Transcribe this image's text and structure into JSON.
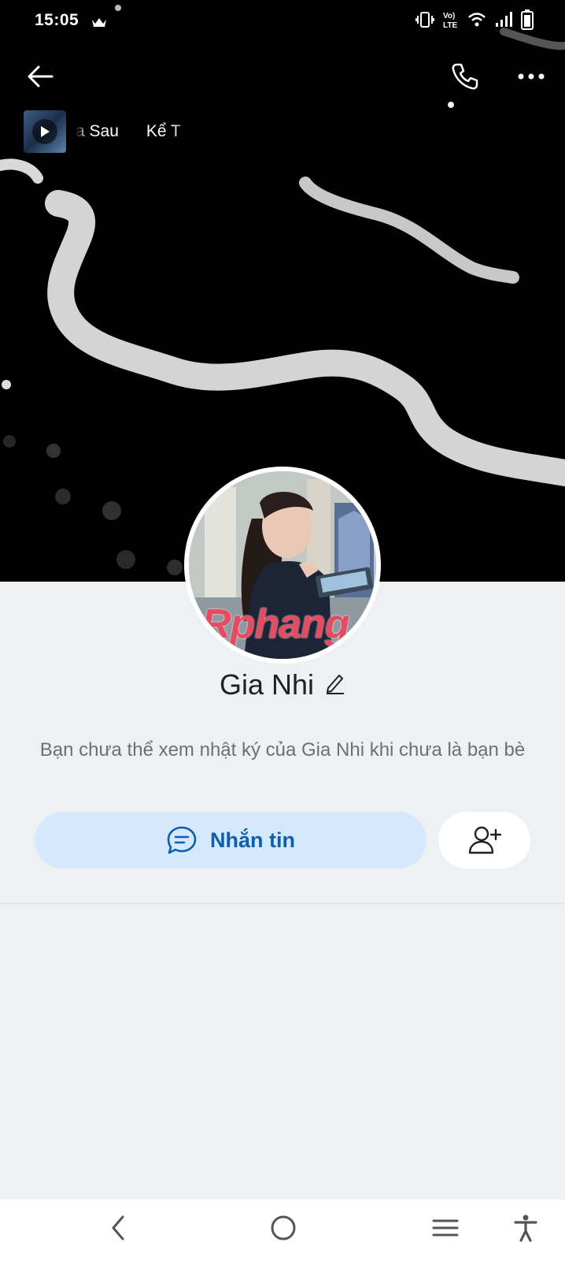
{
  "status_bar": {
    "time": "15:05",
    "icons": [
      "crown-icon",
      "vibrate-icon",
      "volte-icon",
      "wifi-icon",
      "signal-icon",
      "battery-icon"
    ]
  },
  "top_bar": {
    "icons": [
      "back-arrow-icon",
      "phone-icon",
      "more-icon"
    ]
  },
  "music": {
    "text": "a Sau      Kể T",
    "icon": "play-icon"
  },
  "profile": {
    "name": "Gia Nhi",
    "watermark": "Rphang",
    "notice": "Bạn chưa thể xem nhật ký của Gia Nhi khi chưa là bạn bè"
  },
  "actions": {
    "message_label": "Nhắn tin",
    "message_icon": "chat-bubble-icon",
    "add_friend_icon": "add-friend-icon"
  },
  "colors": {
    "accent": "#0a5fb4",
    "message_button_bg": "#d6e9fc",
    "page_bg": "#eef0f2",
    "cover_bg": "#000000"
  },
  "nav_bar": {
    "icons": [
      "nav-back-icon",
      "nav-home-icon",
      "nav-recents-icon",
      "accessibility-icon"
    ]
  }
}
